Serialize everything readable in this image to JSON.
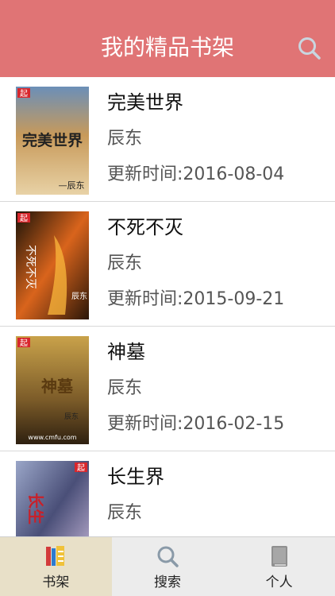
{
  "header": {
    "title": "我的精品书架",
    "search_icon": "search-icon"
  },
  "books": [
    {
      "title": "完美世界",
      "author": "辰东",
      "updated": "更新时间:2016-08-04",
      "cover_text": "完美世界",
      "cover_badge": "起",
      "cover_author": "—辰东"
    },
    {
      "title": "不死不灭",
      "author": "辰东",
      "updated": "更新时间:2015-09-21",
      "cover_text": "不死不灭",
      "cover_badge": "起",
      "cover_author": "辰东"
    },
    {
      "title": "神墓",
      "author": "辰东",
      "updated": "更新时间:2016-02-15",
      "cover_text": "神墓",
      "cover_badge": "起",
      "cover_author": "辰东",
      "cover_url": "www.cmfu.com"
    },
    {
      "title": "长生界",
      "author": "辰东",
      "updated": "",
      "cover_text": "长生",
      "cover_badge": "起"
    }
  ],
  "tabs": [
    {
      "label": "书架",
      "icon": "bookshelf-icon",
      "active": true
    },
    {
      "label": "搜索",
      "icon": "search-icon",
      "active": false
    },
    {
      "label": "个人",
      "icon": "book-icon",
      "active": false
    }
  ],
  "colors": {
    "header": "#e07475",
    "active_tab": "#e8e0c8",
    "tabbar": "#ececec"
  }
}
